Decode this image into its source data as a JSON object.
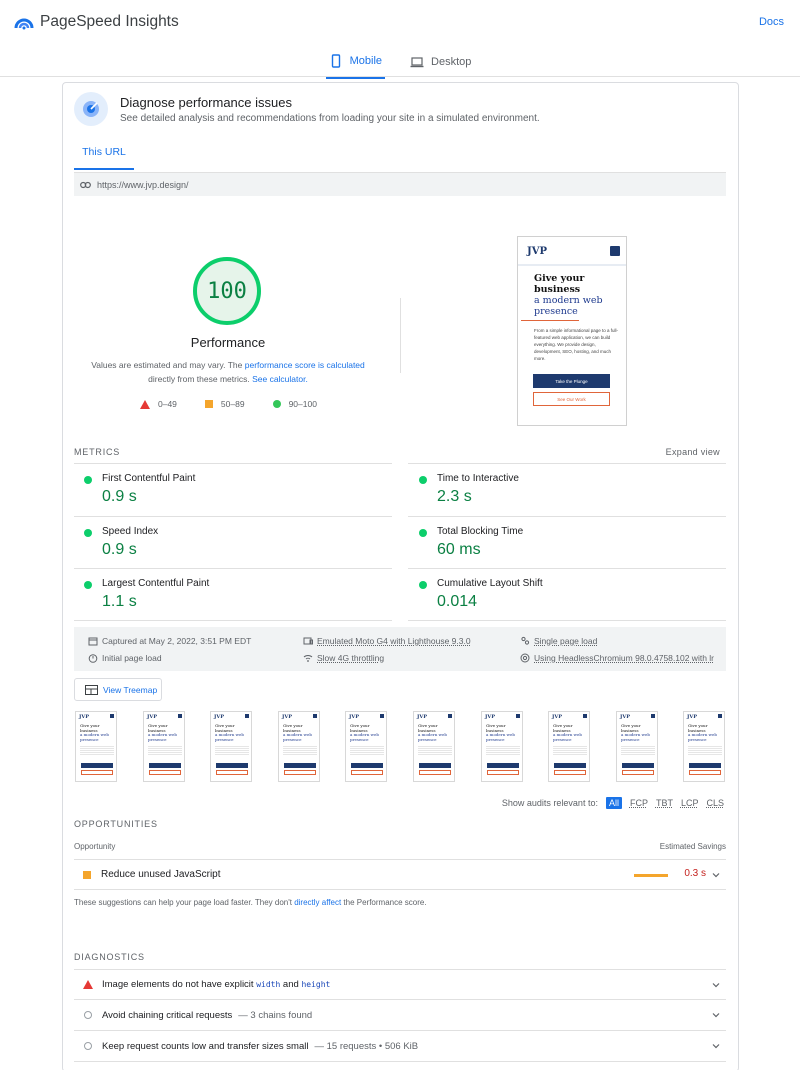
{
  "header": {
    "app_name": "PageSpeed Insights",
    "docs_label": "Docs"
  },
  "device_tabs": [
    {
      "label": "Mobile",
      "active": true,
      "icon": "phone-icon"
    },
    {
      "label": "Desktop",
      "active": false,
      "icon": "laptop-icon"
    }
  ],
  "diagnose": {
    "title": "Diagnose performance issues",
    "subtitle": "See detailed analysis and recommendations from loading your site in a simulated environment.",
    "tab_label": "This URL",
    "url": "https://www.jvp.design/"
  },
  "score": {
    "value": "100",
    "label": "Performance",
    "note_prefix": "Values are estimated and may vary. The ",
    "note_link": "performance score is calculated",
    "note_middle": "directly from these metrics. ",
    "note_link2": "See calculator.",
    "legend": [
      {
        "range": "0–49",
        "shape": "triangle",
        "color": "#e53935"
      },
      {
        "range": "50–89",
        "shape": "square",
        "color": "#f4a52c"
      },
      {
        "range": "90–100",
        "shape": "circle",
        "color": "#34c759"
      }
    ]
  },
  "preview": {
    "logo": "JVP",
    "heading_1": "Give your business",
    "heading_2": "a modern web presence",
    "body": "From a simple informational page to a full-featured web application, we can build everything. We provide design, development, SEO, hosting, and much more.",
    "btn_primary": "Take the Plunge",
    "btn_secondary": "See Our Work"
  },
  "metrics": {
    "section_label": "METRICS",
    "expand_label": "Expand view",
    "items": [
      {
        "name": "First Contentful Paint",
        "value": "0.9 s"
      },
      {
        "name": "Time to Interactive",
        "value": "2.3 s"
      },
      {
        "name": "Speed Index",
        "value": "0.9 s"
      },
      {
        "name": "Total Blocking Time",
        "value": "60 ms"
      },
      {
        "name": "Largest Contentful Paint",
        "value": "1.1 s"
      },
      {
        "name": "Cumulative Layout Shift",
        "value": "0.014"
      }
    ]
  },
  "info": {
    "captured": "Captured at May 2, 2022, 3:51 PM EDT",
    "initial_load": "Initial page load",
    "emulated": "Emulated Moto G4 with Lighthouse 9.3.0",
    "throttling": "Slow 4G throttling",
    "single_load": "Single page load",
    "browser": "Using HeadlessChromium 98.0.4758.102 with lr"
  },
  "treemap_label": "View Treemap",
  "filmstrip_count": 10,
  "audit_filter": {
    "label": "Show audits relevant to:",
    "chips": [
      "All",
      "FCP",
      "TBT",
      "LCP",
      "CLS"
    ]
  },
  "opportunities": {
    "section_label": "OPPORTUNITIES",
    "col_opportunity": "Opportunity",
    "col_savings": "Estimated Savings",
    "items": [
      {
        "title": "Reduce unused JavaScript",
        "savings": "0.3 s"
      }
    ],
    "note_prefix": "These suggestions can help your page load faster. They don't ",
    "note_link": "directly affect",
    "note_suffix": " the Performance score."
  },
  "diagnostics": {
    "section_label": "DIAGNOSTICS",
    "item1_prefix": "Image elements do not have explicit ",
    "item1_code1": "width",
    "item1_and": " and ",
    "item1_code2": "height",
    "item2_title": "Avoid chaining critical requests",
    "item2_detail": "— 3 chains found",
    "item3_title": "Keep request counts low and transfer sizes small",
    "item3_detail": "— 15 requests • 506 KiB"
  }
}
